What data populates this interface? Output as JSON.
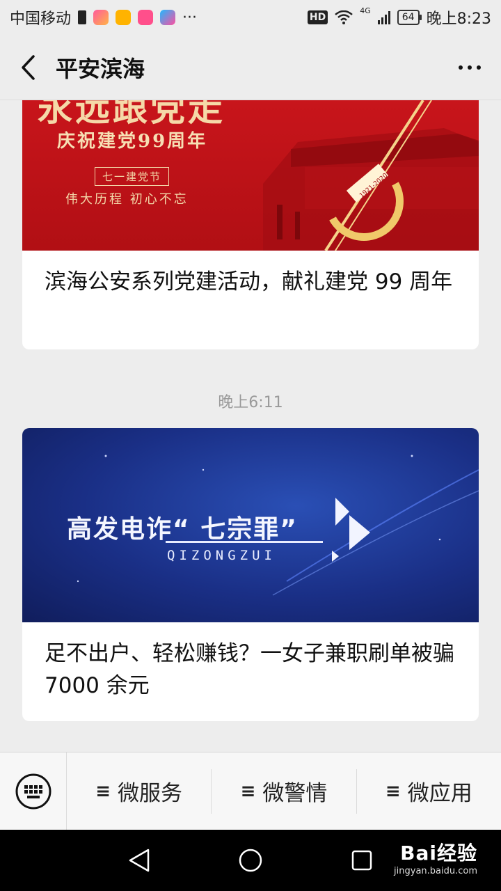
{
  "status_bar": {
    "carrier": "中国移动",
    "network": "4G",
    "hd": "HD",
    "battery": "64",
    "time": "晚上8:23",
    "more": "···"
  },
  "header": {
    "title": "平安滨海",
    "back_icon": "chevron-left-icon",
    "more_icon": "more-dots-icon"
  },
  "articles": [
    {
      "banner_heading": "永远跟党走",
      "banner_subtitle": "庆祝建党99周年",
      "banner_tag": "七一建党节",
      "banner_slogan": "伟大历程 初心不忘",
      "banner_years": "1921-2020",
      "title": "滨海公安系列党建活动，献礼建党 99 周年"
    },
    {
      "banner_heading": "高发电诈“ 七宗罪”",
      "banner_pinyin": "QIZONGZUI",
      "title": "足不出户、轻松赚钱？一女子兼职刷单被骗 7000 余元"
    }
  ],
  "timestamp": "晚上6:11",
  "menu": {
    "keyboard_icon": "keyboard-icon",
    "items": [
      {
        "label": "微服务",
        "glyph": "≡"
      },
      {
        "label": "微警情",
        "glyph": "≡"
      },
      {
        "label": "微应用",
        "glyph": "≡"
      }
    ]
  },
  "nav": {
    "back_icon": "triangle-back-icon",
    "home_icon": "circle-home-icon",
    "recents_icon": "square-recents-icon"
  },
  "watermark": {
    "brand": "Bai经验",
    "url": "jingyan.baidu.com"
  },
  "colors": {
    "banner_red": "#c8151b",
    "banner_blue": "#1a2f86",
    "background": "#ededed"
  }
}
